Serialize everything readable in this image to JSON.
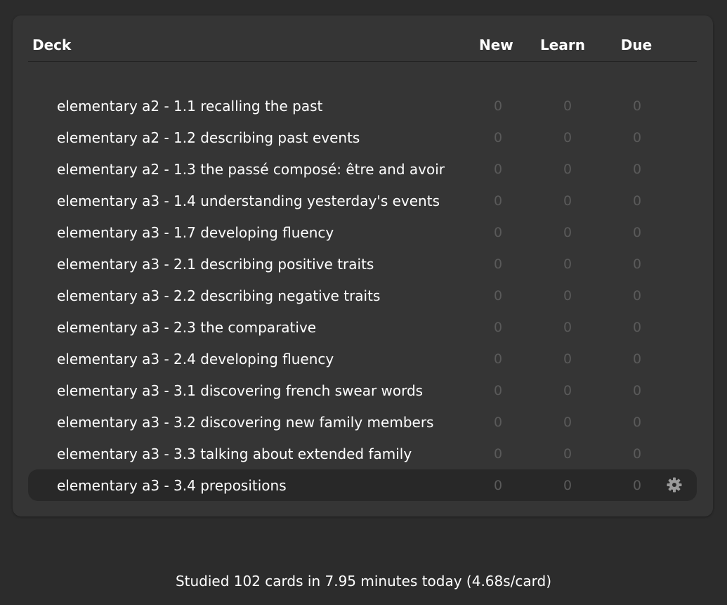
{
  "table": {
    "headers": {
      "deck": "Deck",
      "new": "New",
      "learn": "Learn",
      "due": "Due"
    },
    "rows": [
      {
        "name": "elementary a2 - 1.1 recalling the past",
        "new": "0",
        "learn": "0",
        "due": "0"
      },
      {
        "name": "elementary a2 - 1.2 describing past events",
        "new": "0",
        "learn": "0",
        "due": "0"
      },
      {
        "name": "elementary a2 - 1.3 the passé composé: être and avoir",
        "new": "0",
        "learn": "0",
        "due": "0"
      },
      {
        "name": "elementary a3 - 1.4 understanding yesterday's events",
        "new": "0",
        "learn": "0",
        "due": "0"
      },
      {
        "name": "elementary a3 - 1.7 developing fluency",
        "new": "0",
        "learn": "0",
        "due": "0"
      },
      {
        "name": "elementary a3 - 2.1 describing positive traits",
        "new": "0",
        "learn": "0",
        "due": "0"
      },
      {
        "name": "elementary a3 - 2.2 describing negative traits",
        "new": "0",
        "learn": "0",
        "due": "0"
      },
      {
        "name": "elementary a3 - 2.3 the comparative",
        "new": "0",
        "learn": "0",
        "due": "0"
      },
      {
        "name": "elementary a3 - 2.4 developing fluency",
        "new": "0",
        "learn": "0",
        "due": "0"
      },
      {
        "name": "elementary a3 - 3.1 discovering french swear words",
        "new": "0",
        "learn": "0",
        "due": "0"
      },
      {
        "name": "elementary a3 - 3.2 discovering new family members",
        "new": "0",
        "learn": "0",
        "due": "0"
      },
      {
        "name": "elementary a3 - 3.3 talking about extended family",
        "new": "0",
        "learn": "0",
        "due": "0"
      },
      {
        "name": "elementary a3 - 3.4 prepositions",
        "new": "0",
        "learn": "0",
        "due": "0"
      }
    ],
    "current_row_index": 12,
    "options_icon": "gear-icon"
  },
  "footer": {
    "text": "Studied 102 cards in 7.95 minutes today (4.68s/card)"
  },
  "colors": {
    "background": "#2c2c2c",
    "panel": "#353535",
    "current_row": "#282828",
    "text": "#ffffff",
    "zero_count": "#5a5a5a",
    "gear": "#9a9a9a"
  }
}
